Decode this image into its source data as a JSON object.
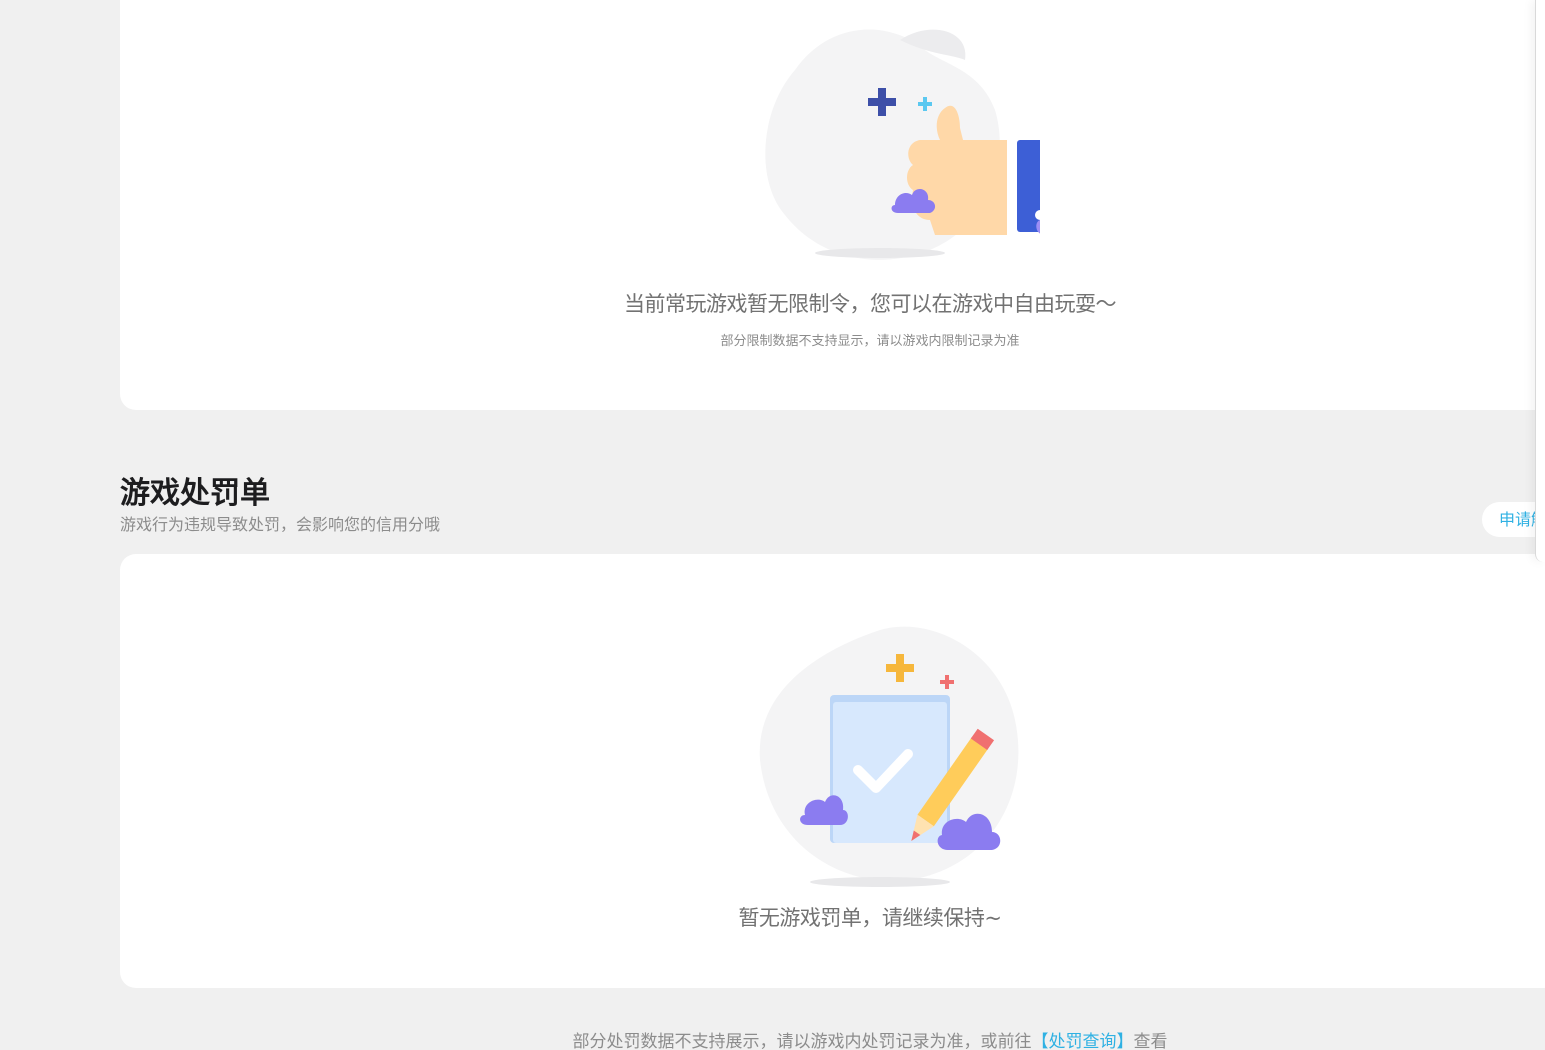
{
  "restriction": {
    "empty_title": "当前常玩游戏暂无限制令，您可以在游戏中自由玩耍～",
    "empty_subtitle": "部分限制数据不支持显示，请以游戏内限制记录为准",
    "illustration_icon": "thumbs-up-icon"
  },
  "penalty_section": {
    "title": "游戏处罚单",
    "subtitle": "游戏行为违规导致处罚，会影响您的信用分哦",
    "apply_button_label": "申请解除",
    "empty_title": "暂无游戏罚单，请继续保持~",
    "illustration_icon": "checklist-pencil-icon"
  },
  "footer": {
    "note_prefix": "部分处罚数据不支持展示，请以游戏内处罚记录为准，或前往",
    "link_label": "【处罚查询】",
    "note_suffix": "查看"
  },
  "colors": {
    "accent": "#2fb1e3",
    "page_bg": "#f0f0f0",
    "card_bg": "#ffffff",
    "title_text": "#1d1d1f",
    "muted_text": "#8c8c8c"
  }
}
